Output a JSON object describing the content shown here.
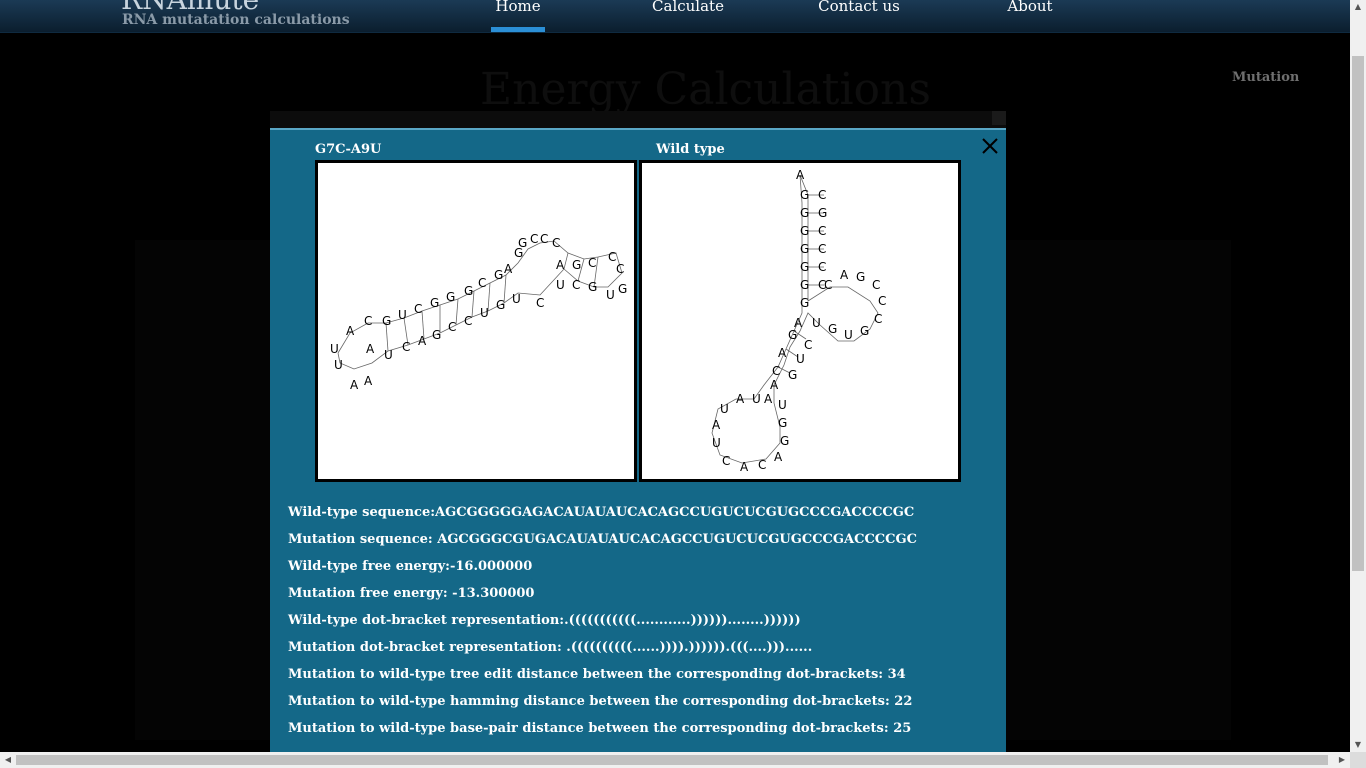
{
  "header": {
    "logo": "RNAmute",
    "tagline": "RNA mutatation calculations",
    "nav": [
      "Home",
      "Calculate",
      "Contact us",
      "About"
    ]
  },
  "background": {
    "title": "Energy Calculations",
    "side_label": "Mutation"
  },
  "modal": {
    "left_title": "G7C-A9U",
    "right_title": "Wild type",
    "info": [
      "Wild-type sequence:AGCGGGGGAGACAUAUAUCACAGCCUGUCUCGUGCCCGACCCCGC",
      "Mutation sequence: AGCGGGCGUGACAUAUAUCACAGCCUGUCUCGUGCCCGACCCCGC",
      "Wild-type free energy:-16.000000",
      "Mutation free energy: -13.300000",
      "Wild-type dot-bracket representation:.(((((((((((............))))))........))))))",
      "Mutation dot-bracket representation: .((((((((((......)))).)))))).(((....)))......",
      "Mutation to wild-type tree edit distance between the corresponding dot-brackets: 34",
      "Mutation to wild-type hamming distance between the corresponding dot-brackets: 22",
      "Mutation to wild-type base-pair distance between the corresponding dot-brackets: 25"
    ]
  },
  "icons": {
    "close": "close-icon",
    "scroll_up": "arrow-up-icon",
    "scroll_down": "arrow-down-icon",
    "scroll_left": "arrow-left-icon",
    "scroll_right": "arrow-right-icon"
  },
  "colors": {
    "modal_bg": "#146888",
    "nav_active": "#2b8fd6",
    "header_bg": "#0b1e2e"
  }
}
